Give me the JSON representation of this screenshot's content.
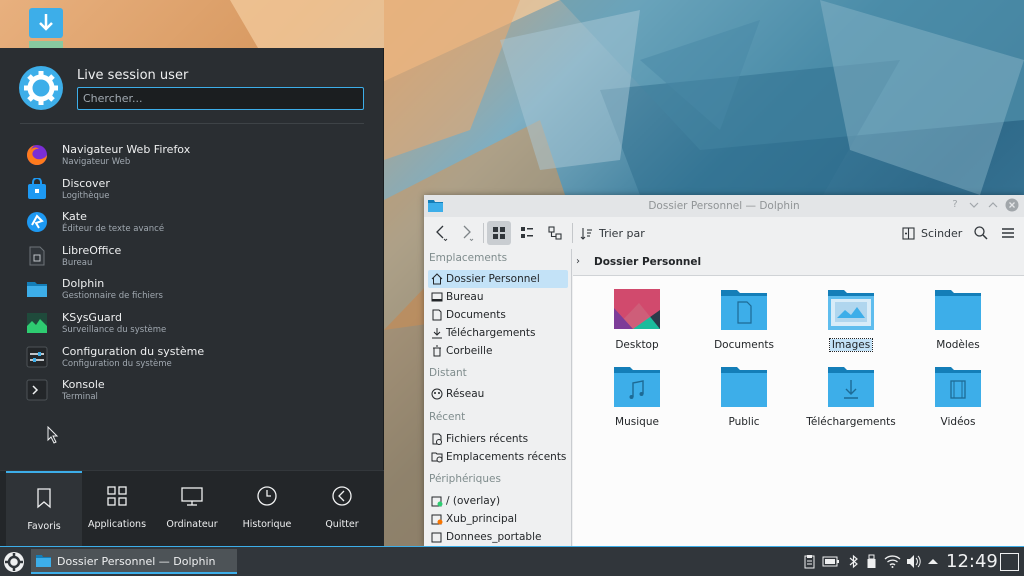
{
  "desktop": {
    "download_icon": "download-icon"
  },
  "launcher": {
    "user_name": "Live session user",
    "search_placeholder": "Chercher...",
    "apps": [
      {
        "name": "Navigateur Web Firefox",
        "desc": "Navigateur Web",
        "icon": "firefox-icon"
      },
      {
        "name": "Discover",
        "desc": "Logithèque",
        "icon": "discover-icon"
      },
      {
        "name": "Kate",
        "desc": "Éditeur de texte avancé",
        "icon": "kate-icon"
      },
      {
        "name": "LibreOffice",
        "desc": "Bureau",
        "icon": "libreoffice-icon"
      },
      {
        "name": "Dolphin",
        "desc": "Gestionnaire de fichiers",
        "icon": "dolphin-icon"
      },
      {
        "name": "KSysGuard",
        "desc": "Surveillance du système",
        "icon": "ksysguard-icon"
      },
      {
        "name": "Configuration du système",
        "desc": "Configuration du système",
        "icon": "system-settings-icon"
      },
      {
        "name": "Konsole",
        "desc": "Terminal",
        "icon": "konsole-icon"
      }
    ],
    "tabs": [
      {
        "label": "Favoris",
        "icon": "bookmark-icon",
        "active": true
      },
      {
        "label": "Applications",
        "icon": "grid-icon"
      },
      {
        "label": "Ordinateur",
        "icon": "monitor-icon"
      },
      {
        "label": "Historique",
        "icon": "clock-icon"
      },
      {
        "label": "Quitter",
        "icon": "leave-icon"
      }
    ]
  },
  "dolphin": {
    "title": "Dossier Personnel — Dolphin",
    "toolbar": {
      "sort_label": "Trier par",
      "split_label": "Scinder"
    },
    "places": {
      "sections": {
        "emplacements": "Emplacements",
        "distant": "Distant",
        "recent": "Récent",
        "peripheriques": "Périphériques"
      },
      "emplacements": [
        "Dossier Personnel",
        "Bureau",
        "Documents",
        "Téléchargements",
        "Corbeille"
      ],
      "distant": [
        "Réseau"
      ],
      "recent": [
        "Fichiers récents",
        "Emplacements récents"
      ],
      "peripheriques": [
        "/ (overlay)",
        "Xub_principal",
        "Donnees_portable"
      ]
    },
    "breadcrumb": "Dossier Personnel",
    "files": [
      {
        "name": "Desktop",
        "icon": "desktop-folder-icon"
      },
      {
        "name": "Documents",
        "icon": "documents-folder-icon"
      },
      {
        "name": "Images",
        "icon": "pictures-folder-icon",
        "selected": true
      },
      {
        "name": "Modèles",
        "icon": "templates-folder-icon"
      },
      {
        "name": "Musique",
        "icon": "music-folder-icon"
      },
      {
        "name": "Public",
        "icon": "public-folder-icon"
      },
      {
        "name": "Téléchargements",
        "icon": "downloads-folder-icon"
      },
      {
        "name": "Vidéos",
        "icon": "videos-folder-icon"
      }
    ]
  },
  "taskbar": {
    "task_label": "Dossier Personnel — Dolphin",
    "clock": "12:49"
  },
  "colors": {
    "accent": "#3daee9",
    "folder": "#3daee9",
    "panel": "#31363b"
  }
}
